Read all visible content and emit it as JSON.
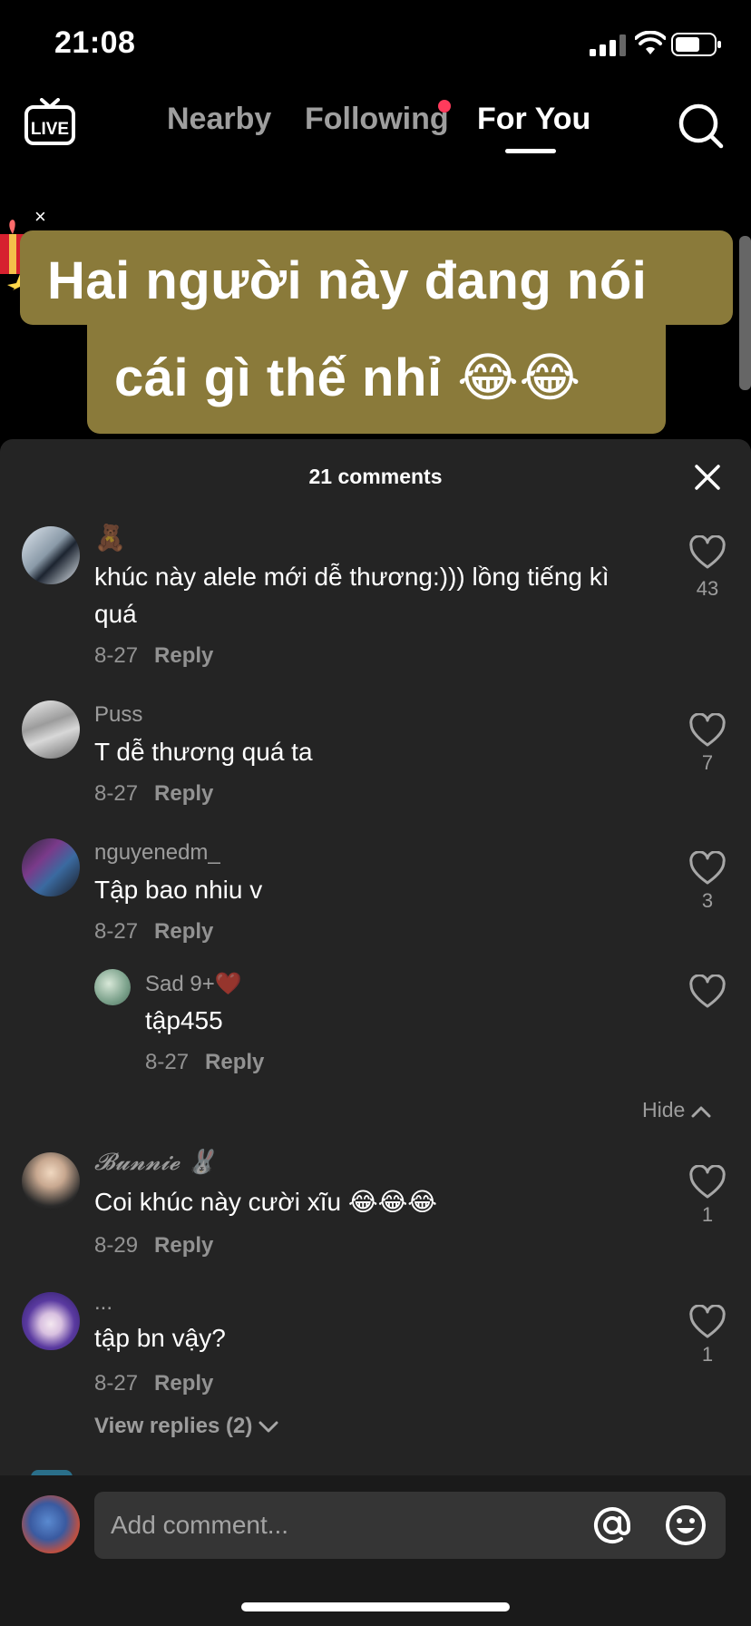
{
  "status_bar": {
    "time": "21:08"
  },
  "nav": {
    "tabs": [
      {
        "label": "Nearby"
      },
      {
        "label": "Following"
      },
      {
        "label": "For You"
      }
    ],
    "active_tab": "For You",
    "accent_color": "#ff3b5c"
  },
  "caption": {
    "line1": "Hai người này đang nói",
    "line2": "cái gì thế nhỉ 😂😂",
    "close": "×"
  },
  "comments_sheet": {
    "title": "21 comments",
    "comments": [
      {
        "user": "🧸",
        "text": "khúc này alele mới dễ thương:))) lồng tiếng kì quá",
        "date": "8-27",
        "reply": "Reply",
        "likes": "43"
      },
      {
        "user": "Puss",
        "text": "T dễ thương quá ta",
        "date": "8-27",
        "reply": "Reply",
        "likes": "7"
      },
      {
        "user": "nguyenedm_",
        "text": "Tập bao nhiu v",
        "date": "8-27",
        "reply": "Reply",
        "likes": "3"
      },
      {
        "user": "Sad 9+❤️",
        "text": "tập455",
        "date": "8-27",
        "reply": "Reply",
        "likes": ""
      },
      {
        "user": "𝓑𝓾𝓷𝓷𝓲𝓮 🐰",
        "text": "Coi khúc này cười xĩu 😂😂😂",
        "date": "8-29",
        "reply": "Reply",
        "likes": "1"
      },
      {
        "user": "...",
        "text": "tập bn vậy?",
        "date": "8-27",
        "reply": "Reply",
        "likes": "1"
      }
    ],
    "hide_label": "Hide",
    "view_replies": "View replies (2)"
  },
  "input": {
    "placeholder": "Add comment..."
  }
}
